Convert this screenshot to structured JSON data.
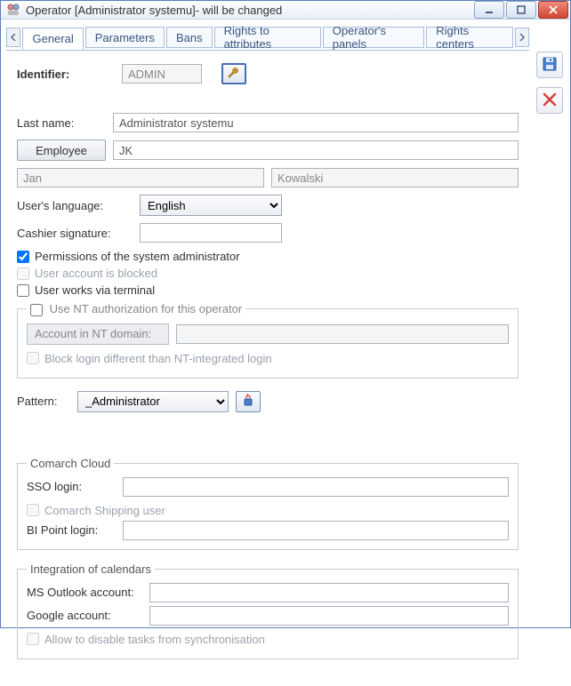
{
  "window": {
    "title": "Operator [Administrator systemu]- will be changed"
  },
  "tabs": [
    {
      "label": "General",
      "active": true
    },
    {
      "label": "Parameters",
      "active": false
    },
    {
      "label": "Bans",
      "active": false
    },
    {
      "label": "Rights to attributes",
      "active": false
    },
    {
      "label": "Operator's panels",
      "active": false
    },
    {
      "label": "Rights centers",
      "active": false
    }
  ],
  "identifier": {
    "label": "Identifier:",
    "value": "ADMIN"
  },
  "lastName": {
    "label": "Last name:",
    "value": "Administrator systemu"
  },
  "employee": {
    "button": "Employee",
    "acronym": "JK",
    "firstName": "Jan",
    "surname": "Kowalski"
  },
  "language": {
    "label": "User's language:",
    "value": "English"
  },
  "cashierSig": {
    "label": "Cashier signature:",
    "value": ""
  },
  "checks": {
    "sysadmin": "Permissions of the system administrator",
    "blocked": "User account is blocked",
    "terminal": "User works via terminal"
  },
  "nt": {
    "legend": "Use NT authorization for this operator",
    "accountLabel": "Account in NT domain:",
    "accountValue": "",
    "blockLogin": "Block login different than NT-integrated login"
  },
  "pattern": {
    "label": "Pattern:",
    "value": "_Administrator"
  },
  "cloud": {
    "legend": "Comarch Cloud",
    "ssoLabel": "SSO login:",
    "ssoValue": "",
    "shippingUser": "Comarch Shipping user",
    "biLabel": "BI Point login:",
    "biValue": ""
  },
  "calendars": {
    "legend": "Integration of calendars",
    "outlookLabel": "MS Outlook account:",
    "outlookValue": "",
    "googleLabel": "Google account:",
    "googleValue": "",
    "allowDisable": "Allow to disable tasks from synchronisation"
  },
  "icons": {
    "save": "save-icon",
    "close": "close-icon",
    "wrench": "wrench-icon",
    "fire": "refresh-icon"
  }
}
